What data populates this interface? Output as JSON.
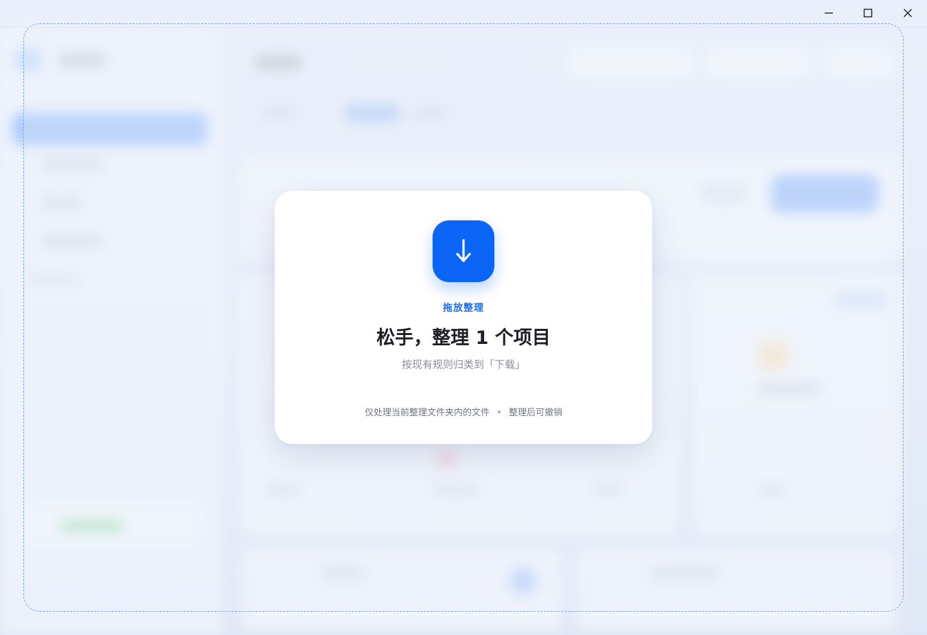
{
  "window": {
    "controls": {
      "minimize": "minimize-icon",
      "maximize": "maximize-icon",
      "close": "close-icon"
    }
  },
  "drop_dialog": {
    "icon": "download-arrow-icon",
    "eyebrow": "拖放整理",
    "headline": "松手，整理 1 个项目",
    "subline": "按现有规则归类到「下载」",
    "notes": [
      "仅处理当前整理文件夹内的文件",
      "整理后可撤销"
    ]
  },
  "colors": {
    "accent": "#0b66f7",
    "dropzone_border": "#7aa6e8",
    "headline": "#1c1f26",
    "muted": "#8a8f99"
  }
}
